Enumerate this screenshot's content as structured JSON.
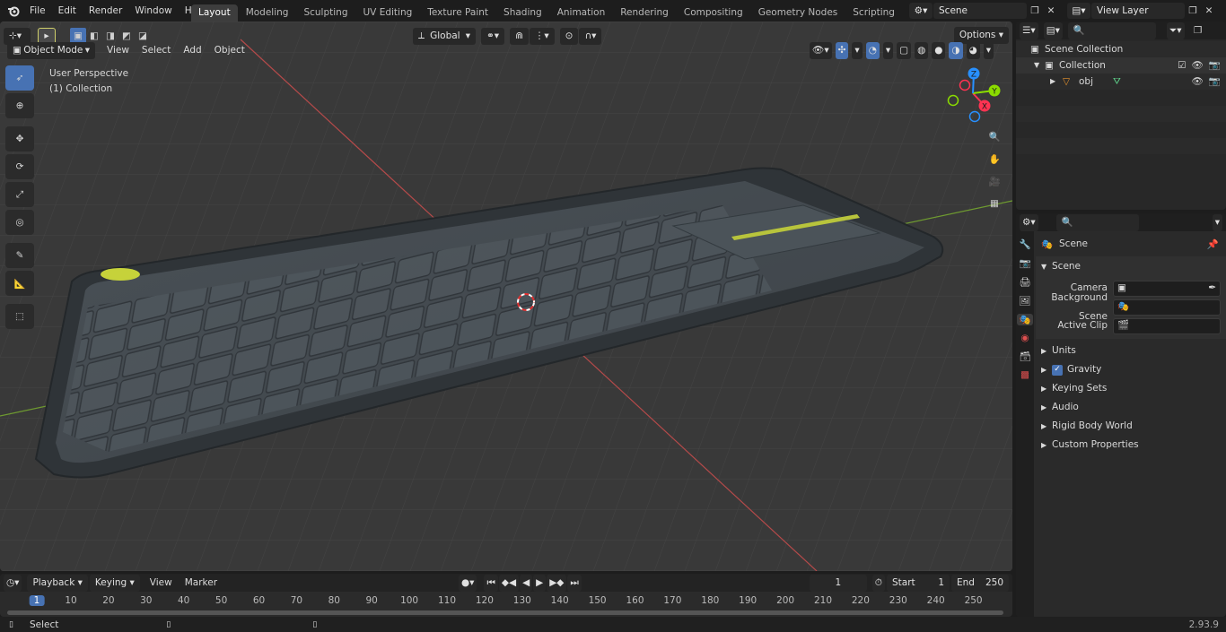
{
  "menu": [
    "File",
    "Edit",
    "Render",
    "Window",
    "Help"
  ],
  "workspaces": [
    "Layout",
    "Modeling",
    "Sculpting",
    "UV Editing",
    "Texture Paint",
    "Shading",
    "Animation",
    "Rendering",
    "Compositing",
    "Geometry Nodes",
    "Scripting"
  ],
  "scene": "Scene",
  "view_layer": "View Layer",
  "viewport": {
    "mode": "Object Mode",
    "menus": [
      "View",
      "Select",
      "Add",
      "Object"
    ],
    "transform_orientation": "Global",
    "options": "Options",
    "perspective_label": "User Perspective",
    "collection_label": "(1) Collection",
    "axes": {
      "x": "X",
      "y": "Y",
      "z": "Z"
    }
  },
  "outliner": {
    "root": "Scene Collection",
    "collection": "Collection",
    "object": "obj"
  },
  "properties": {
    "context": "Scene",
    "panel": "Scene",
    "fields": [
      {
        "label": "Camera",
        "value": ""
      },
      {
        "label": "Background Scene",
        "value": ""
      },
      {
        "label": "Active Clip",
        "value": ""
      }
    ],
    "sections": [
      "Units",
      "Gravity",
      "Keying Sets",
      "Audio",
      "Rigid Body World",
      "Custom Properties"
    ]
  },
  "timeline": {
    "menus": [
      "Playback",
      "Keying",
      "View",
      "Marker"
    ],
    "current_frame": "1",
    "start_label": "Start",
    "start": "1",
    "end_label": "End",
    "end": "250",
    "ruler": [
      "1",
      "10",
      "20",
      "30",
      "40",
      "50",
      "60",
      "70",
      "80",
      "90",
      "100",
      "110",
      "120",
      "130",
      "140",
      "150",
      "160",
      "170",
      "180",
      "190",
      "200",
      "210",
      "220",
      "230",
      "240",
      "250"
    ]
  },
  "status": {
    "left": "Select",
    "version": "2.93.9"
  },
  "colors": {
    "accent": "#4772b3",
    "x_axis": "#ff3352",
    "y_axis": "#8bdc00",
    "z_axis": "#2890ff"
  }
}
